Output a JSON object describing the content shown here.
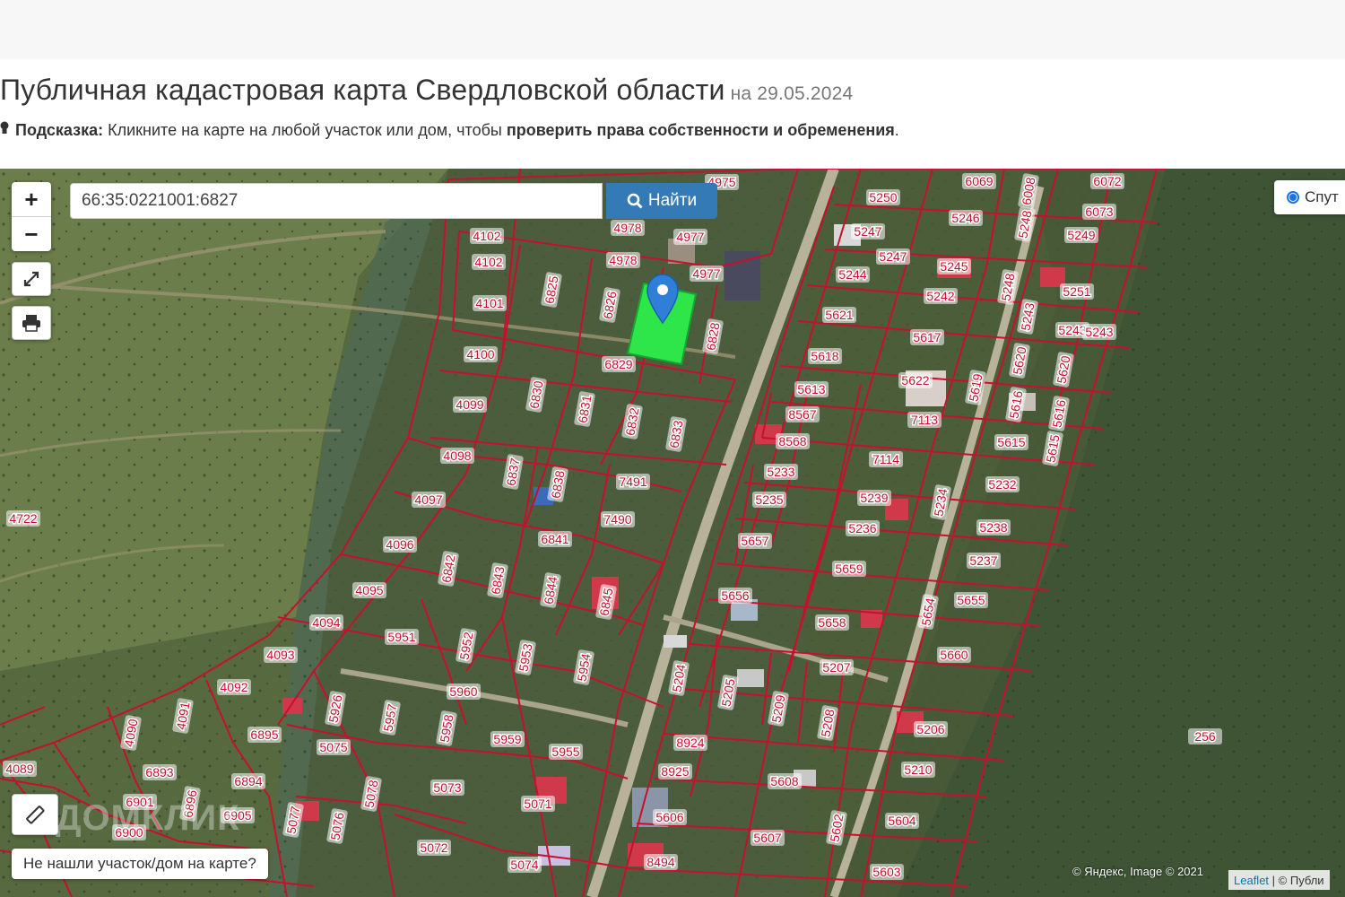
{
  "header": {
    "title": "Публичная кадастровая карта Свердловской области",
    "date": "на 29.05.2024",
    "hint_label": "Подсказка:",
    "hint_text": "Кликните на карте на любой участок или дом, чтобы",
    "hint_bold": "проверить права собственности и обременения",
    "hint_end": "."
  },
  "map": {
    "zoom_in": "+",
    "zoom_out": "−",
    "fullscreen_icon": "expand-icon",
    "print_icon": "printer-icon",
    "ruler_icon": "ruler-icon",
    "search_value": "66:35:0221001:6827",
    "search_button": "Найти",
    "layer_option": "Спут",
    "not_found": "Не нашли участок/дом на карте?",
    "attribution": "© Яндекс, Image © 2021",
    "leaflet": "Leaflet",
    "publ": "| © Публи",
    "watermark": "ДОМКЛИК",
    "yandex_mark": "Yandex",
    "selected_parcel": "6827",
    "colors": {
      "parcel_border": "#c8102e",
      "label_bg": "#ffffff",
      "label_text": "#c8102e",
      "selected_fill": "#2ee64a",
      "marker": "#2f7fd8",
      "button": "#337ab7"
    },
    "parcel_labels": [
      "4975",
      "6069",
      "6072",
      "6073",
      "5250",
      "5246",
      "6008",
      "5248",
      "5249",
      "4102",
      "4978",
      "4977",
      "5247",
      "5247",
      "5245",
      "5251",
      "5244",
      "4102",
      "4978",
      "4977",
      "5243",
      "5242",
      "5248",
      "5243",
      "4101",
      "6825",
      "6826",
      "6828",
      "5621",
      "5617",
      "5243",
      "5620",
      "5620",
      "4100",
      "6829",
      "5618",
      "5622",
      "5619",
      "5616",
      "5616",
      "5613",
      "8567",
      "7113",
      "4099",
      "6830",
      "6831",
      "6832",
      "6833",
      "8568",
      "5615",
      "5615",
      "7114",
      "4098",
      "6837",
      "6838",
      "7491",
      "5233",
      "5232",
      "5234",
      "5239",
      "4097",
      "5235",
      "5236",
      "5238",
      "7490",
      "4722",
      "6841",
      "4096",
      "5657",
      "5237",
      "6842",
      "6843",
      "5659",
      "4095",
      "6844",
      "6845",
      "5656",
      "5655",
      "5654",
      "4094",
      "5951",
      "5952",
      "5658",
      "4093",
      "5953",
      "5954",
      "5660",
      "5207",
      "5960",
      "5204",
      "5205",
      "5209",
      "5208",
      "4092",
      "4090",
      "4091",
      "5926",
      "5957",
      "5958",
      "6895",
      "5075",
      "5959",
      "5955",
      "8924",
      "5206",
      "256",
      "4089",
      "6893",
      "8925",
      "5210",
      "6894",
      "5073",
      "5071",
      "5608",
      "5078",
      "6901",
      "6896",
      "5077",
      "6905",
      "5076",
      "5606",
      "5604",
      "6900",
      "5607",
      "5602",
      "5072",
      "5074",
      "8494",
      "5603"
    ]
  }
}
